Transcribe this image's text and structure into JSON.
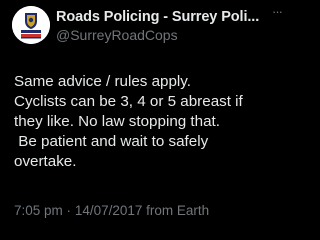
{
  "author": {
    "display_name": "Roads Policing - Surrey Poli...",
    "handle": "@SurreyRoadCops",
    "avatar_icon": "surrey-police-crest-icon"
  },
  "menu": {
    "more_label": "···"
  },
  "tweet": {
    "lines": [
      "Same advice / rules apply.",
      "Cyclists can be 3, 4 or 5 abreast if",
      "they like. No law stopping that.",
      " Be patient and wait to safely",
      "overtake."
    ],
    "time": "7:05 pm",
    "separator": "·",
    "date": "14/07/2017",
    "source": "from Earth"
  },
  "colors": {
    "background": "#000000",
    "primary_text": "#e7e9ea",
    "secondary_text": "#71767b"
  }
}
